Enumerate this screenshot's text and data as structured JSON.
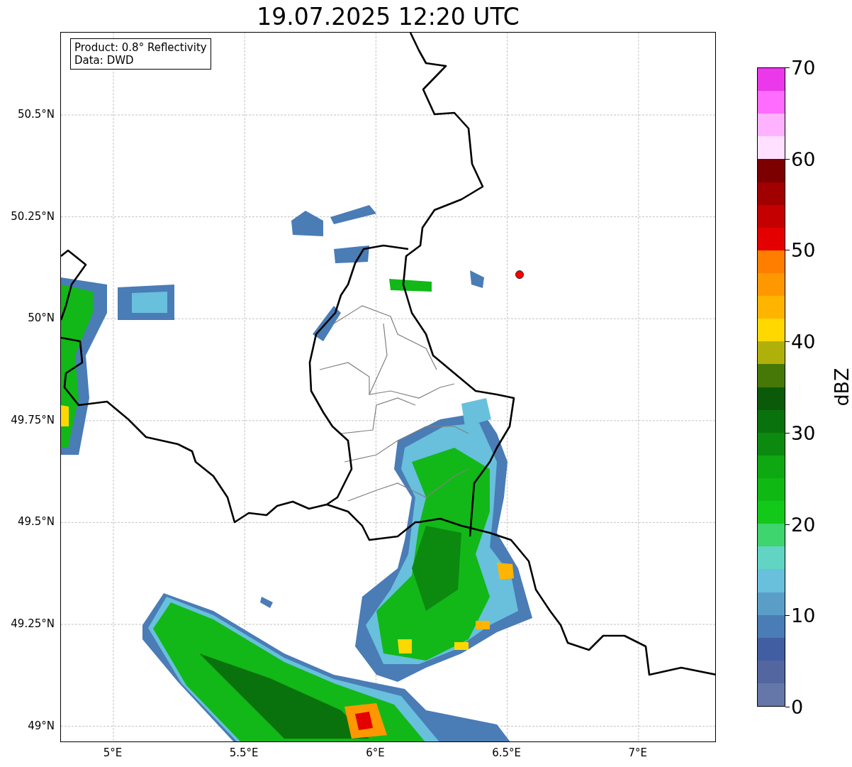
{
  "title": "19.07.2025 12:20 UTC",
  "info_box": [
    "Product: 0.8° Reflectivity",
    "Data: DWD"
  ],
  "lat_ticks": [
    "50.5°N",
    "50.25°N",
    "50°N",
    "49.75°N",
    "49.5°N",
    "49.25°N",
    "49°N"
  ],
  "lon_ticks": [
    "5°E",
    "5.5°E",
    "6°E",
    "6.5°E",
    "7°E"
  ],
  "colorbar": {
    "label": "dBZ",
    "ticks": [
      "70",
      "60",
      "50",
      "40",
      "30",
      "20",
      "10",
      "0"
    ],
    "bins": [
      {
        "color": "#ea38ea"
      },
      {
        "color": "#ff6cff"
      },
      {
        "color": "#ffb2ff"
      },
      {
        "color": "#ffe0ff"
      },
      {
        "color": "#7c0000"
      },
      {
        "color": "#a00000"
      },
      {
        "color": "#c40000"
      },
      {
        "color": "#e40000"
      },
      {
        "color": "#ff7e00"
      },
      {
        "color": "#ff9800"
      },
      {
        "color": "#ffb400"
      },
      {
        "color": "#ffd800"
      },
      {
        "color": "#b0b00a"
      },
      {
        "color": "#467808"
      },
      {
        "color": "#0a5a0a"
      },
      {
        "color": "#0a720c"
      },
      {
        "color": "#0c8a10"
      },
      {
        "color": "#0ea812"
      },
      {
        "color": "#10b814"
      },
      {
        "color": "#12c818"
      },
      {
        "color": "#3ed46e"
      },
      {
        "color": "#62d4c4"
      },
      {
        "color": "#68c0dc"
      },
      {
        "color": "#5a9ec8"
      },
      {
        "color": "#4a7cb6"
      },
      {
        "color": "#425ea2"
      },
      {
        "color": "#5466a0"
      },
      {
        "color": "#6577a8"
      }
    ]
  }
}
